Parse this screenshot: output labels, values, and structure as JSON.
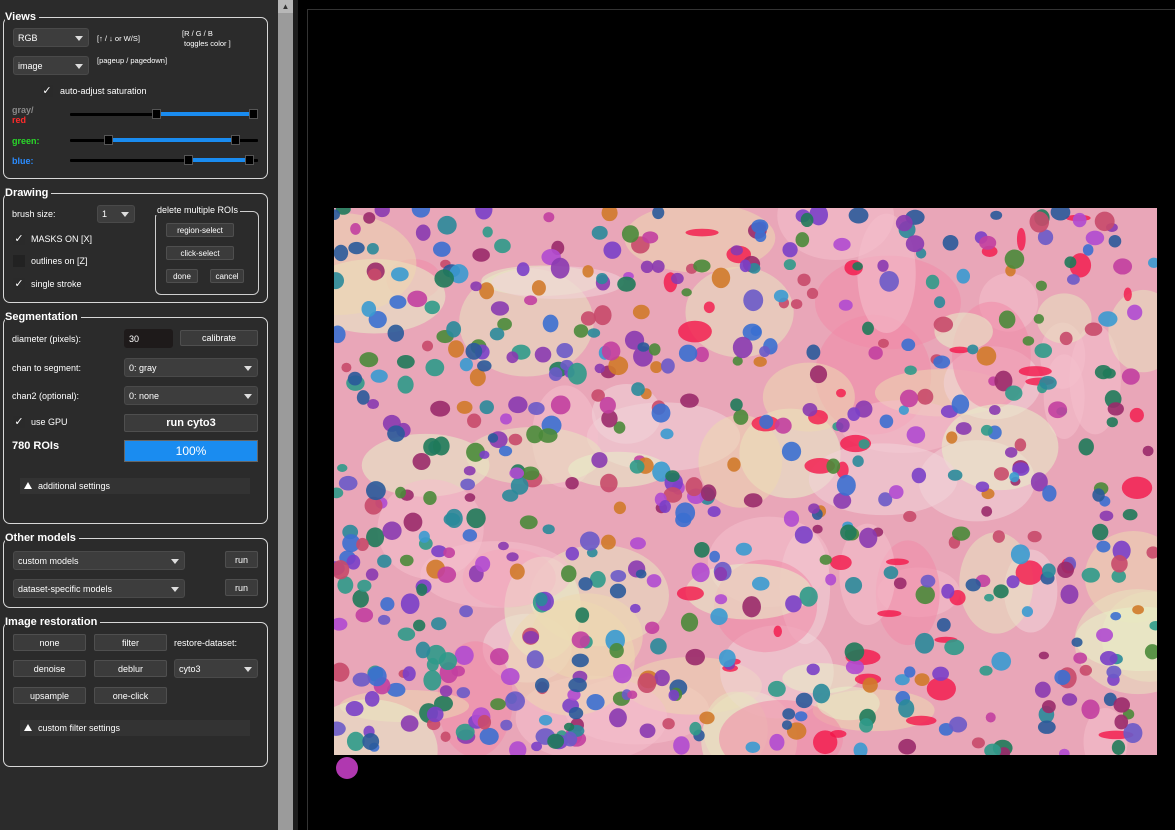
{
  "views": {
    "title": "Views",
    "color_mode": "RGB",
    "hint_arrows": "[↑ / ↓ or W/S]",
    "hint_rgb_line1": "[R / G / B",
    "hint_rgb_line2": "toggles color ]",
    "view_select": "image",
    "hint_page": "[pageup / pagedown]",
    "auto_adjust": "auto-adjust saturation",
    "gray_label": "gray/",
    "red_label": "red",
    "green_label": "green:",
    "blue_label": "blue:",
    "colors": {
      "gray": "#8a8a8a",
      "red": "#ff2a2a",
      "green": "#29d829",
      "blue": "#2b8cff"
    },
    "saturation": {
      "gray_red": [
        0.46,
        1.0
      ],
      "green": [
        0.2,
        0.88
      ],
      "blue": [
        0.63,
        0.95
      ]
    }
  },
  "drawing": {
    "title": "Drawing",
    "brush_label": "brush size:",
    "brush_value": "1",
    "masks_on": "MASKS ON [X]",
    "outlines_on": "outlines on [Z]",
    "single_stroke": "single stroke",
    "delete_group_title": "delete multiple ROIs",
    "region_select": "region-select",
    "click_select": "click-select",
    "done": "done",
    "cancel": "cancel"
  },
  "segmentation": {
    "title": "Segmentation",
    "diameter_label": "diameter (pixels):",
    "diameter_value": "30",
    "calibrate": "calibrate",
    "chan_label": "chan to segment:",
    "chan_value": "0: gray",
    "chan2_label": "chan2 (optional):",
    "chan2_value": "0: none",
    "use_gpu": "use GPU",
    "run_model": "run cyto3",
    "roi_count": "780 ROIs",
    "progress_text": "100%",
    "progress_fraction": 1.0,
    "additional_settings": "additional settings",
    "progress_color": "#1a8cf0"
  },
  "other_models": {
    "title": "Other models",
    "custom_models": "custom models",
    "dataset_models": "dataset-specific models",
    "run1": "run",
    "run2": "run"
  },
  "restoration": {
    "title": "Image restoration",
    "none": "none",
    "filter": "filter",
    "restore_dataset_label": "restore-dataset:",
    "denoise": "denoise",
    "deblur": "deblur",
    "dataset_value": "cyto3",
    "upsample": "upsample",
    "one_click": "one-click",
    "custom_filter": "custom filter settings"
  },
  "viewer": {
    "brush_cursor_color": "#b038b0",
    "tissue_base": "#e9a6b8",
    "cell_palette": [
      "#3b6fd0",
      "#7a3fc8",
      "#2f9a8a",
      "#c23fa0",
      "#4a8a3a",
      "#d07a2a",
      "#2a5a9a",
      "#9a2a6a",
      "#1f7a5a",
      "#b04ad0",
      "#3a9ad0",
      "#6a5ac8",
      "#c84a6a",
      "#2a8a9a",
      "#8a3ab0"
    ]
  }
}
